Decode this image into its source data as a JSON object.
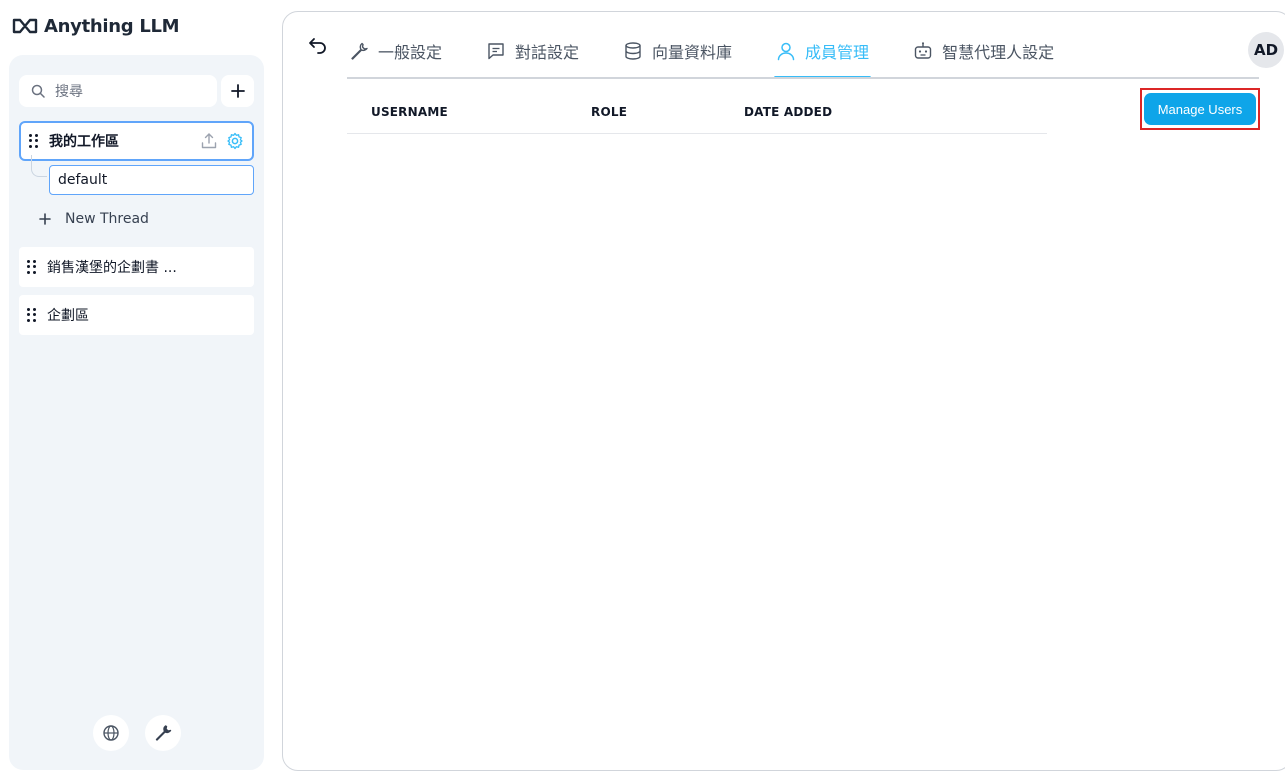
{
  "app": {
    "logo_text": "Anything LLM"
  },
  "sidebar": {
    "search_placeholder": "搜尋",
    "workspaces": [
      {
        "name": "我的工作區",
        "active": true
      },
      {
        "name": "銷售漢堡的企劃書 ..."
      },
      {
        "name": "企劃區"
      }
    ],
    "thread": "default",
    "new_thread_label": "New Thread",
    "footer_icons": [
      "globe-icon",
      "wrench-icon"
    ]
  },
  "tabs": [
    {
      "label": "一般設定",
      "icon": "wrench-icon"
    },
    {
      "label": "對話設定",
      "icon": "chat-icon"
    },
    {
      "label": "向量資料庫",
      "icon": "database-icon"
    },
    {
      "label": "成員管理",
      "icon": "user-icon",
      "active": true
    },
    {
      "label": "智慧代理人設定",
      "icon": "robot-icon"
    }
  ],
  "avatar": "AD",
  "table": {
    "columns": [
      "USERNAME",
      "ROLE",
      "DATE ADDED"
    ]
  },
  "manage_users_label": "Manage Users",
  "colors": {
    "accent": "#38bdf8",
    "button": "#0ea5e9",
    "highlight": "#dc2626"
  }
}
